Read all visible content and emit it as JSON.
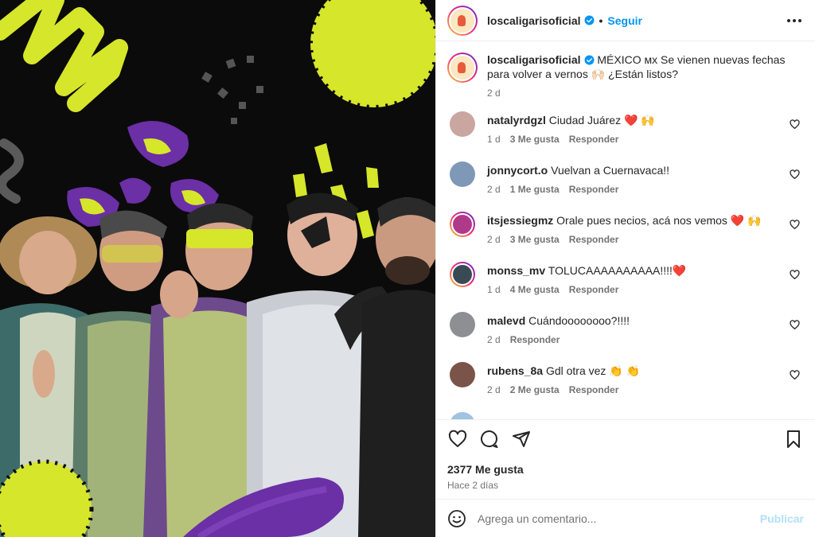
{
  "post": {
    "media_alt": "Band photo of Los Caligaris",
    "colors": {
      "accent": "#0095f6",
      "heart": "#ed4956",
      "neon": "#d6e62a",
      "purple": "#6b2fa6"
    }
  },
  "header": {
    "username": "loscaligarisoficial",
    "separator": "•",
    "follow_label": "Seguir",
    "more_icon": "more-horizontal-icon"
  },
  "caption": {
    "username": "loscaligarisoficial",
    "text": "MÉXICO ᴍx Se vienen nuevas fechas para volver a vernos 🙌🏻 ¿Están listos?",
    "time": "2 d"
  },
  "comments": [
    {
      "username": "natalyrdgzl",
      "text": "Ciudad Juárez ❤️ 🙌",
      "time": "1 d",
      "likes": "3 Me gusta",
      "reply": "Responder",
      "avatar_color": "#c9a6a0",
      "ring": false
    },
    {
      "username": "jonnycort.o",
      "text": "Vuelvan a Cuernavaca!!",
      "time": "2 d",
      "likes": "1 Me gusta",
      "reply": "Responder",
      "avatar_color": "#7f98b8",
      "ring": false
    },
    {
      "username": "itsjessiegmz",
      "text": "Orale pues necios, acá nos vemos ❤️ 🙌",
      "time": "2 d",
      "likes": "3 Me gusta",
      "reply": "Responder",
      "avatar_color": "#b03a8a",
      "ring": true
    },
    {
      "username": "monss_mv",
      "text": "TOLUCAAAAAAAAAA!!!!❤️",
      "time": "1 d",
      "likes": "4 Me gusta",
      "reply": "Responder",
      "avatar_color": "#3a4a55",
      "ring": true
    },
    {
      "username": "malevd",
      "text": "Cuándoooooooo?!!!!",
      "time": "2 d",
      "likes": "",
      "reply": "Responder",
      "avatar_color": "#8d8f92",
      "ring": false
    },
    {
      "username": "rubens_8a",
      "text": "Gdl otra vez 👏 👏",
      "time": "2 d",
      "likes": "2 Me gusta",
      "reply": "Responder",
      "avatar_color": "#7a5448",
      "ring": false
    }
  ],
  "actions": {
    "like_icon": "heart-icon",
    "comment_icon": "comment-icon",
    "share_icon": "share-icon",
    "save_icon": "bookmark-icon",
    "likes": "2377 Me gusta",
    "ago": "Hace 2 días"
  },
  "composer": {
    "placeholder": "Agrega un comentario...",
    "publish_label": "Publicar",
    "emoji_icon": "emoji-icon"
  }
}
